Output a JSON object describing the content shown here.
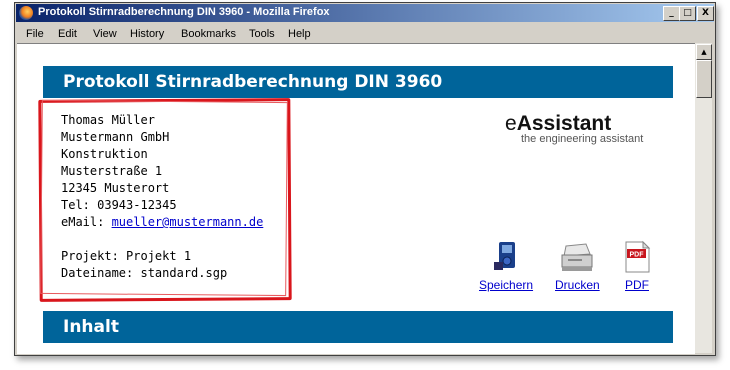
{
  "window": {
    "title": "Protokoll Stirnradberechnung DIN 3960 - Mozilla Firefox",
    "controls": [
      "_",
      "□",
      "X"
    ]
  },
  "menu": [
    "File",
    "Edit",
    "View",
    "History",
    "Bookmarks",
    "Tools",
    "Help"
  ],
  "page": {
    "header": "Protokoll Stirnradberechnung DIN 3960",
    "address": {
      "name": "Thomas Müller",
      "company": "Mustermann GmbH",
      "department": "Konstruktion",
      "street": "Musterstraße 1",
      "city": "12345 Musterort",
      "tel": "Tel: 03943-12345",
      "email_label": "eMail: ",
      "email": "mueller@mustermann.de",
      "project": "Projekt: Projekt 1",
      "file": "Dateiname: standard.sgp"
    },
    "logo": {
      "prefix": "e",
      "name": "Assistant",
      "tagline": "the engineering assistant"
    },
    "actions": {
      "save": "Speichern",
      "print": "Drucken",
      "pdf": "PDF",
      "pdf_badge": "PDF"
    },
    "section": "Inhalt"
  },
  "colors": {
    "banner": "#00649a",
    "stamp": "#d9161c",
    "link": "#0000cc"
  }
}
